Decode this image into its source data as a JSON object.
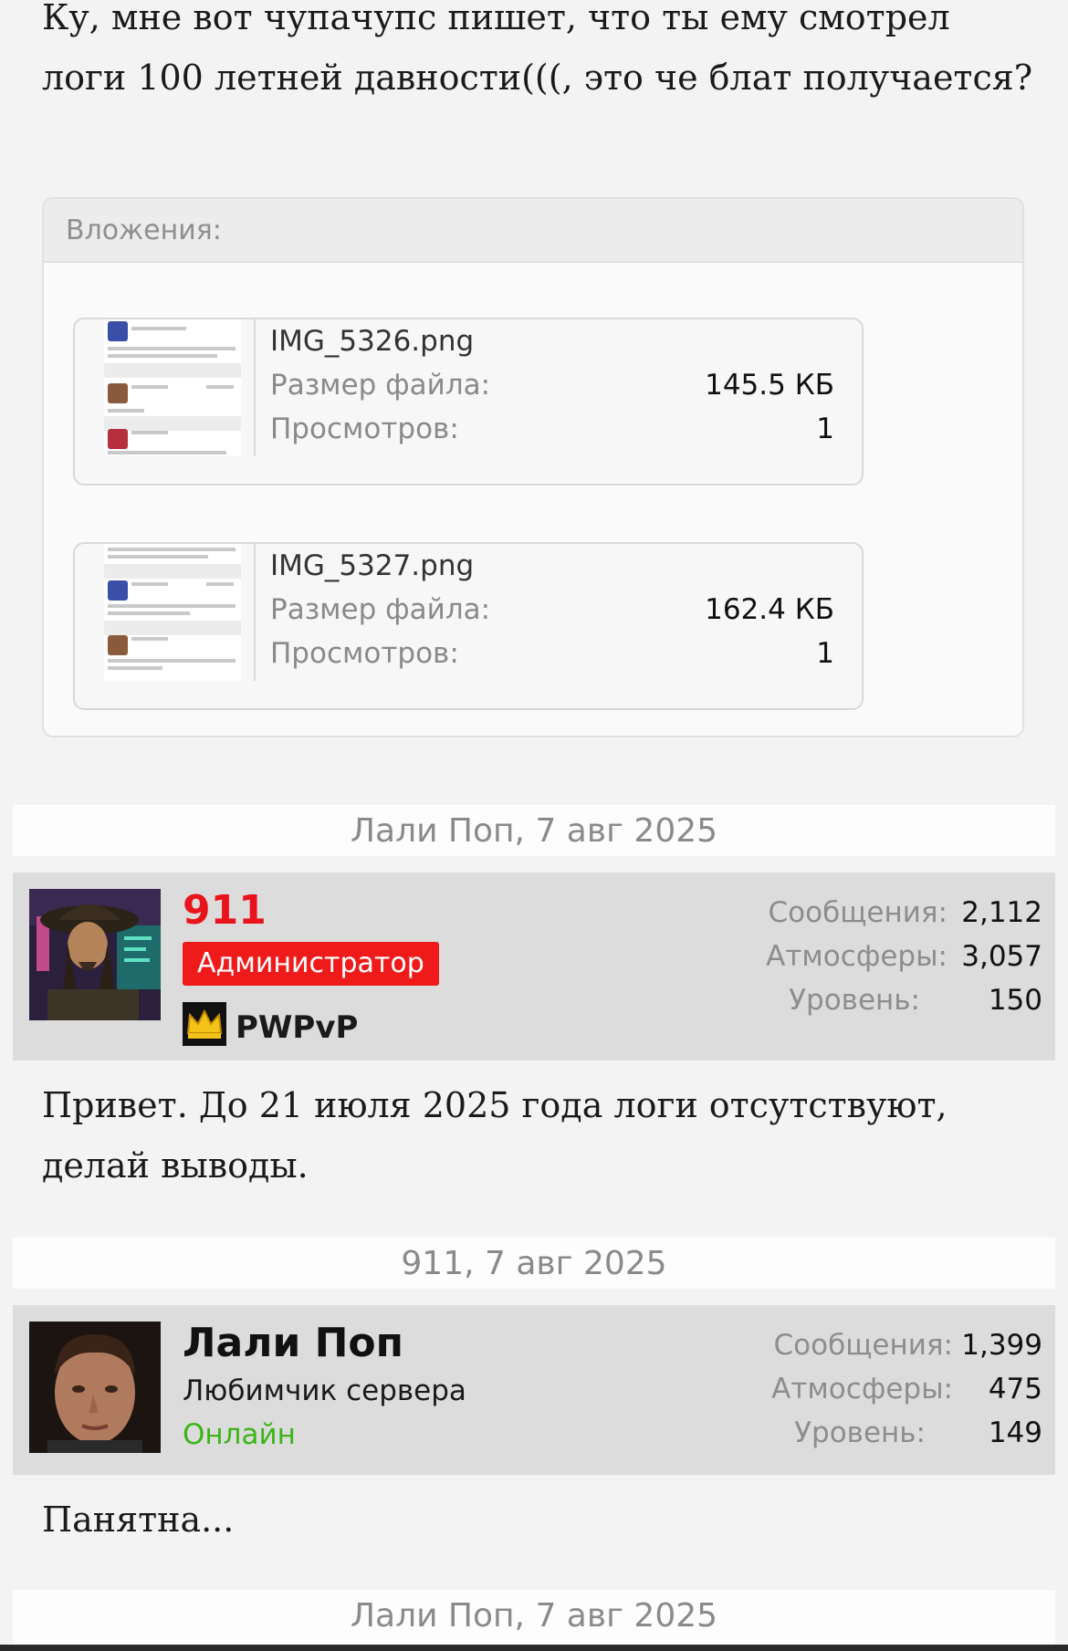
{
  "top_post": {
    "text": "Ку, мне вот чупачупс пишет, что ты ему смотрел логи 100 летней давности(((, это че блат получается?"
  },
  "attachments": {
    "header": "Вложения:",
    "files": [
      {
        "name": "IMG_5326.png",
        "size_label": "Размер файла:",
        "size": "145.5 КБ",
        "views_label": "Просмотров:",
        "views": "1"
      },
      {
        "name": "IMG_5327.png",
        "size_label": "Размер файла:",
        "size": "162.4 КБ",
        "views_label": "Просмотров:",
        "views": "1"
      }
    ]
  },
  "quote_headers": [
    "Лали Поп, 7 авг 2025",
    "911, 7 авг 2025",
    "Лали Поп, 7 авг 2025"
  ],
  "posts": [
    {
      "username": "911",
      "username_color": "#e8131b",
      "role": "Администратор",
      "role_color": "#ef1b1b",
      "server_tag": "PWPvP",
      "stats": {
        "messages_label": "Сообщения:",
        "messages": "2,112",
        "atmos_label": "Атмосферы:",
        "atmos": "3,057",
        "level_label": "Уровень:",
        "level": "150"
      },
      "text": "Привет. До 21 июля 2025 года логи отсутствуют, делай выводы."
    },
    {
      "username": "Лали Поп",
      "role": "Любимчик сервера",
      "status": "Онлайн",
      "status_color": "#3cb517",
      "stats": {
        "messages_label": "Сообщения:",
        "messages": "1,399",
        "atmos_label": "Атмосферы:",
        "atmos": "475",
        "level_label": "Уровень:",
        "level": "149"
      },
      "text": "Панятна..."
    }
  ]
}
